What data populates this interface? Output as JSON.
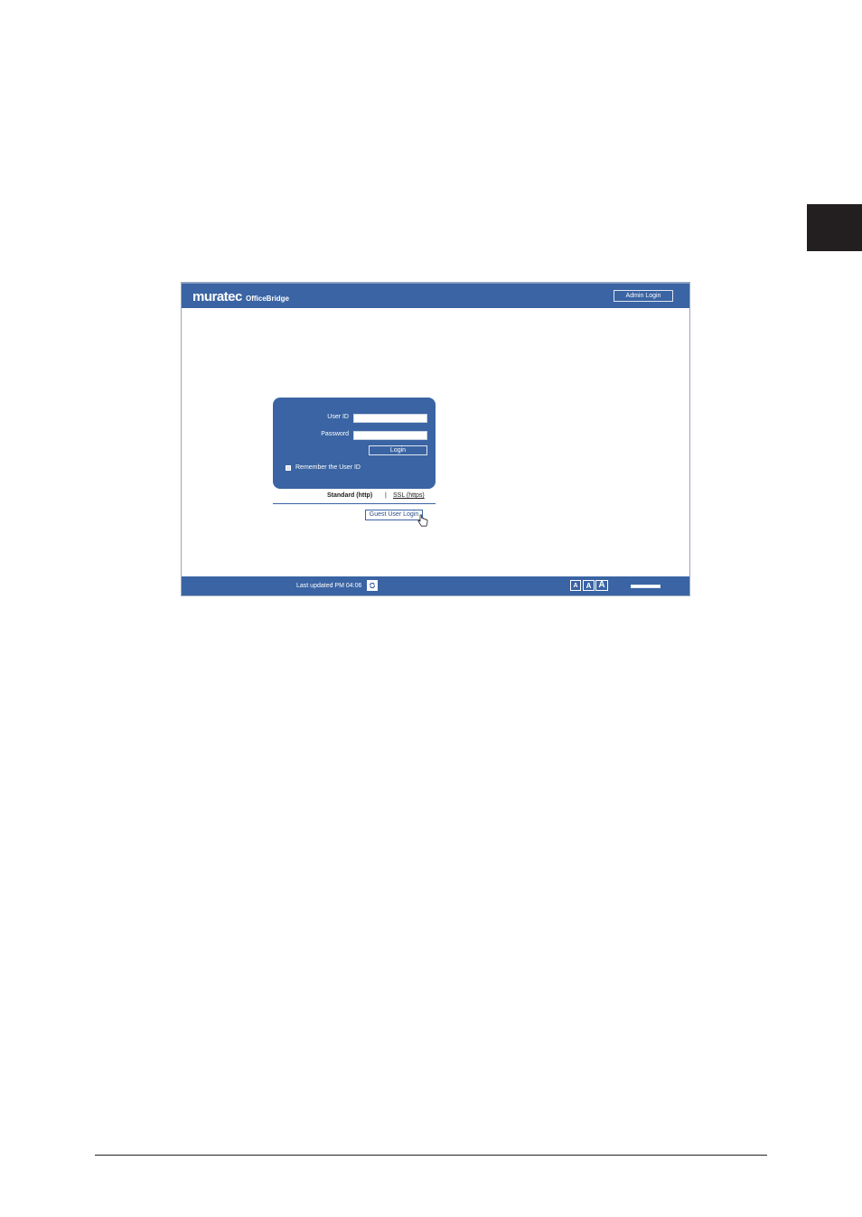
{
  "header": {
    "logo_text": "muratec",
    "product_prefix": "Office",
    "product_suffix": "Bridge",
    "admin_login_label": "Admin Login"
  },
  "login": {
    "user_id_label": "User ID",
    "password_label": "Password",
    "user_id_value": "",
    "password_value": "",
    "login_button_label": "Login",
    "remember_label": "Remember the User ID",
    "remember_checked": false
  },
  "protocol": {
    "standard_label": "Standard (http)",
    "separator": "|",
    "ssl_label": "SSL (https)"
  },
  "guest_login_label": "Guest User Login",
  "footer": {
    "last_updated": "Last updated PM 04:06",
    "font_size_buttons": [
      "A",
      "A",
      "A"
    ]
  },
  "colors": {
    "brand_blue": "#3a64a3",
    "page_black": "#231f20"
  }
}
